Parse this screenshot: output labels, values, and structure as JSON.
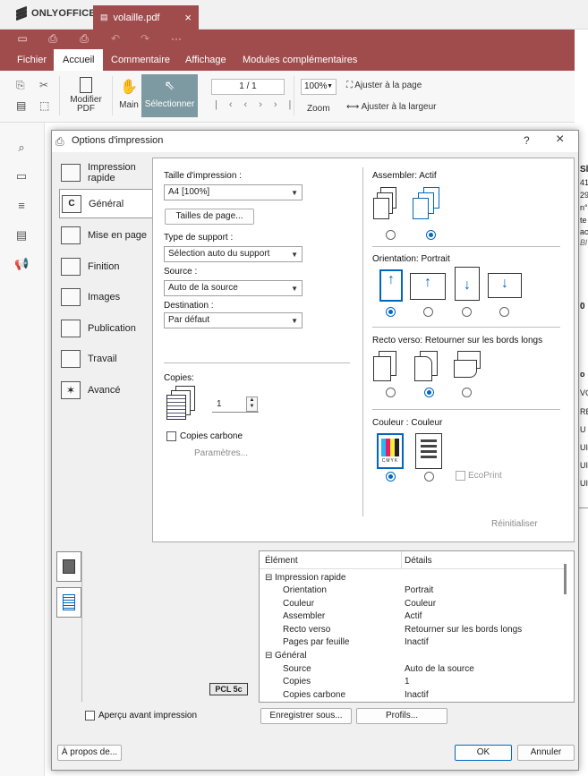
{
  "app": {
    "brand": "ONLYOFFICE",
    "tab_title": "volaille.pdf",
    "tab_close": "×",
    "menu": [
      "Fichier",
      "Accueil",
      "Commentaire",
      "Affichage",
      "Modules complémentaires"
    ],
    "active_menu": "Accueil"
  },
  "ribbon": {
    "edit_pdf": "Modifier PDF",
    "hand": "Main",
    "select": "Sélectionner",
    "page_value": "1 / 1",
    "zoom_value": "100%",
    "zoom_label": "Zoom",
    "fit_page": "Ajuster à la page",
    "fit_width": "Ajuster à la largeur"
  },
  "doc_side_text": [
    "Sl",
    "41",
    "29",
    "n°",
    "te",
    "ac",
    "Bl",
    "0",
    "o",
    "VG",
    "RE",
    "U",
    "UI",
    "UI",
    "UI"
  ],
  "dialog": {
    "title": "Options d'impression",
    "help": "?",
    "close": "×",
    "tabs": [
      "Impression rapide",
      "Général",
      "Mise en page",
      "Finition",
      "Images",
      "Publication",
      "Travail",
      "Avancé"
    ],
    "active_tab": "Général",
    "print_size_label": "Taille d'impression :",
    "print_size_value": "A4  [100%]",
    "page_sizes_button": "Tailles de page...",
    "media_type_label": "Type de support :",
    "media_type_value": "Sélection auto du support",
    "source_label": "Source :",
    "source_value": "Auto de la source",
    "destination_label": "Destination :",
    "destination_value": "Par défaut",
    "copies_label": "Copies:",
    "copies_value": "1",
    "carbon_copies": "Copies carbone",
    "parameters": "Paramètres...",
    "collate_label": "Assembler:",
    "collate_value": "Actif",
    "orientation_label": "Orientation:",
    "orientation_value": "Portrait",
    "duplex_label": "Recto verso:",
    "duplex_value": "Retourner sur les bords longs",
    "color_label": "Couleur :",
    "color_value": "Couleur",
    "cmyk": "CMYK",
    "ecoprint": "EcoPrint",
    "reset": "Réinitialiser",
    "pcl": "PCL 5c",
    "list_header": {
      "element": "Élément",
      "details": "Détails"
    },
    "list_rows": [
      {
        "element": "Impression rapide",
        "details": "",
        "group": true
      },
      {
        "element": "Orientation",
        "details": "Portrait"
      },
      {
        "element": "Couleur",
        "details": "Couleur"
      },
      {
        "element": "Assembler",
        "details": "Actif"
      },
      {
        "element": "Recto verso",
        "details": "Retourner sur les bords longs"
      },
      {
        "element": "Pages par feuille",
        "details": "Inactif"
      },
      {
        "element": "Général",
        "details": "",
        "group": true
      },
      {
        "element": "Source",
        "details": "Auto de la source"
      },
      {
        "element": "Copies",
        "details": "1"
      },
      {
        "element": "Copies carbone",
        "details": "Inactif"
      }
    ],
    "preview_checkbox": "Aperçu avant impression",
    "save_button": "Enregistrer sous...",
    "profiles_button": "Profils...",
    "about_button": "À propos de...",
    "ok_button": "OK",
    "cancel_button": "Annuler"
  },
  "colors": {
    "accent": "#a14c4c",
    "select": "#7d9aa3",
    "radio": "#0067c0"
  }
}
